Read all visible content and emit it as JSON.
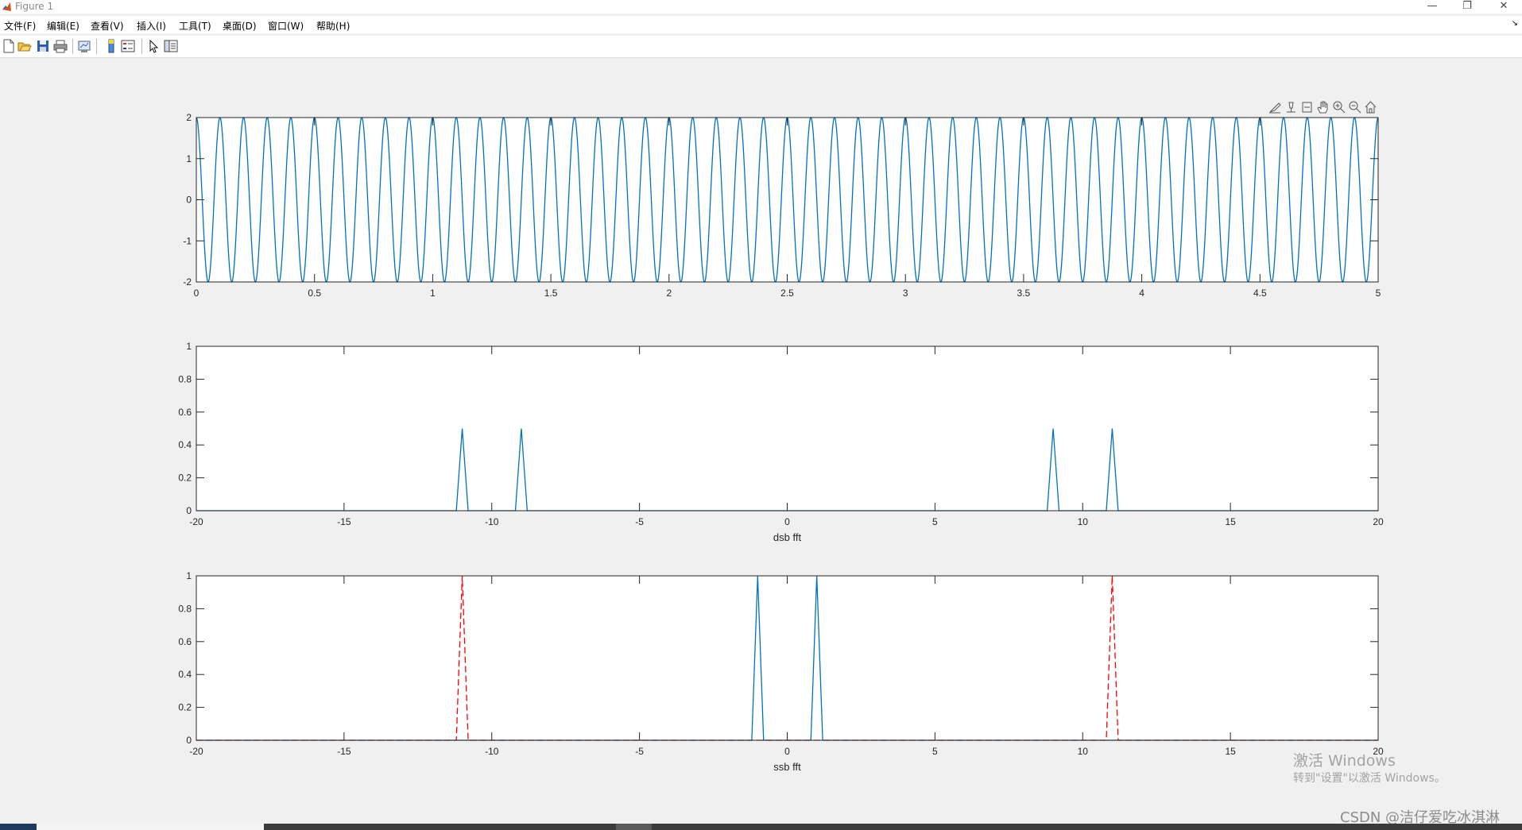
{
  "window": {
    "title": "Figure 1",
    "min_icon": "minimize-icon",
    "max_icon": "restore-icon",
    "close_icon": "close-icon"
  },
  "menu": [
    "文件(F)",
    "编辑(E)",
    "查看(V)",
    "插入(I)",
    "工具(T)",
    "桌面(D)",
    "窗口(W)",
    "帮助(H)"
  ],
  "toolbar_icons": [
    "new-figure-icon",
    "open-file-icon",
    "save-icon",
    "print-icon",
    "link-plot-icon",
    "colorbar-icon",
    "legend-icon",
    "select-arrow-icon",
    "property-inspector-icon"
  ],
  "axes_toolbar_icons": [
    "brush-icon",
    "datatip-icon",
    "restore-view-icon",
    "pan-hand-icon",
    "zoom-in-icon",
    "zoom-out-icon",
    "home-icon"
  ],
  "colors": {
    "series_blue": "#0072BD",
    "dashed_red": "#FF0000",
    "background": "#f0f0f0"
  },
  "chart_data": [
    {
      "type": "line",
      "title": "",
      "xlabel": "",
      "ylabel": "",
      "xlim": [
        0,
        5
      ],
      "ylim": [
        -2,
        2
      ],
      "xticks": [
        0,
        0.5,
        1,
        1.5,
        2,
        2.5,
        3,
        3.5,
        4,
        4.5,
        5
      ],
      "yticks": [
        -2,
        -1,
        0,
        1,
        2
      ],
      "series": [
        {
          "function": "2*cos(2*pi*10*t)*cos(2*pi*1*t) approx. envelope-free cosine at 10 Hz",
          "amplitude": 2,
          "frequency_hz": 10,
          "x_start": 0,
          "x_end": 5,
          "color": "#0072BD",
          "style": "solid"
        }
      ]
    },
    {
      "type": "line",
      "title": "",
      "xlabel": "dsb fft",
      "ylabel": "",
      "xlim": [
        -20,
        20
      ],
      "ylim": [
        0,
        1
      ],
      "xticks": [
        -20,
        -15,
        -10,
        -5,
        0,
        5,
        10,
        15,
        20
      ],
      "yticks": [
        0,
        0.2,
        0.4,
        0.6,
        0.8,
        1
      ],
      "series": [
        {
          "x": [
            -20,
            -11.2,
            -11,
            -10.8,
            -9.2,
            -9,
            -8.8,
            8.8,
            9,
            9.2,
            10.8,
            11,
            11.2,
            20
          ],
          "y": [
            0,
            0,
            0.5,
            0,
            0,
            0.5,
            0,
            0,
            0.5,
            0,
            0,
            0.5,
            0,
            0
          ],
          "color": "#0072BD",
          "style": "solid"
        }
      ]
    },
    {
      "type": "line",
      "title": "",
      "xlabel": "ssb fft",
      "ylabel": "",
      "xlim": [
        -20,
        20
      ],
      "ylim": [
        0,
        1
      ],
      "xticks": [
        -20,
        -15,
        -10,
        -5,
        0,
        5,
        10,
        15,
        20
      ],
      "yticks": [
        0,
        0.2,
        0.4,
        0.6,
        0.8,
        1
      ],
      "series": [
        {
          "x": [
            -20,
            -1.2,
            -1,
            -0.8,
            0.8,
            1,
            1.2,
            20
          ],
          "y": [
            0,
            0,
            1,
            0,
            0,
            1,
            0,
            0
          ],
          "color": "#0072BD",
          "style": "solid"
        },
        {
          "x": [
            -20,
            -11.2,
            -11,
            -10.8,
            10.8,
            11,
            11.2,
            20
          ],
          "y": [
            0,
            0,
            1,
            0,
            0,
            1,
            0,
            0
          ],
          "color": "#FF0000",
          "style": "dashed"
        }
      ]
    }
  ],
  "watermark": {
    "line1": "激活 Windows",
    "line2": "转到\"设置\"以激活 Windows。"
  },
  "credit": "CSDN @洁仔爱吃冰淇淋"
}
